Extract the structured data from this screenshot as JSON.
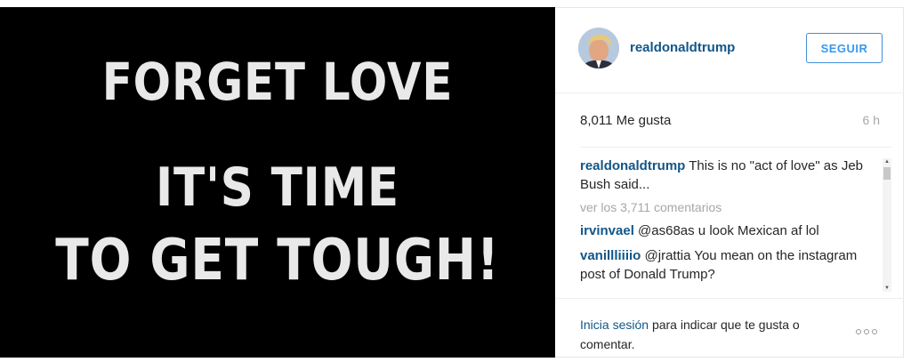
{
  "post_image": {
    "lines": [
      "FORGET LOVE",
      "IT'S TIME",
      "TO GET TOUGH!"
    ]
  },
  "header": {
    "username": "realdonaldtrump",
    "follow_label": "SEGUIR"
  },
  "stats": {
    "likes": "8,011 Me gusta",
    "time": "6 h"
  },
  "caption": {
    "user": "realdonaldtrump",
    "text": "This is no \"act of love\" as Jeb Bush said..."
  },
  "view_all": "ver los 3,711 comentarios",
  "comments": [
    {
      "user": "irvinvael",
      "text": "@as68as u look Mexican af lol"
    },
    {
      "user": "vanillliiiio",
      "text": "@jrattia You mean on the instagram post of Donald Trump?"
    }
  ],
  "footer": {
    "login_link": "Inicia sesión",
    "login_rest": "para indicar que te gusta o comentar."
  },
  "icons": {
    "avatar": "profile-photo",
    "more": "more-options-icon",
    "scroll_up": "scroll-up-arrow",
    "scroll_down": "scroll-down-arrow"
  },
  "colors": {
    "link_blue": "#125688",
    "button_blue": "#3897f0",
    "meta_gray": "#a5a7aa"
  }
}
